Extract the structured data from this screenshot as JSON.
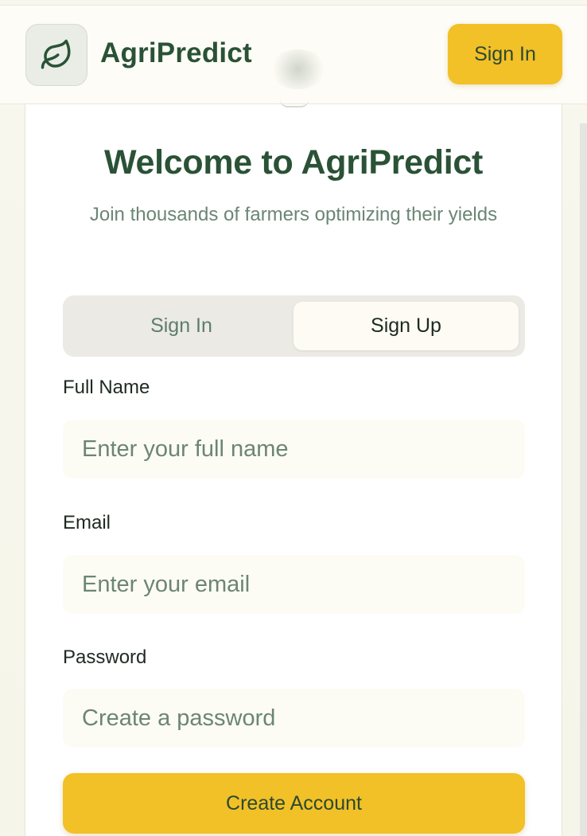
{
  "header": {
    "brand": "AgriPredict",
    "logo_icon": "leaf-icon",
    "signin_label": "Sign In"
  },
  "card": {
    "title": "Welcome to AgriPredict",
    "subtitle": "Join thousands of farmers optimizing their yields"
  },
  "tabs": [
    {
      "label": "Sign In",
      "active": false
    },
    {
      "label": "Sign Up",
      "active": true
    }
  ],
  "form": {
    "full_name": {
      "label": "Full Name",
      "placeholder": "Enter your full name",
      "value": ""
    },
    "email": {
      "label": "Email",
      "placeholder": "Enter your email",
      "value": ""
    },
    "password": {
      "label": "Password",
      "placeholder": "Create a password",
      "value": ""
    },
    "submit_label": "Create Account"
  },
  "colors": {
    "brand_green": "#2a5236",
    "accent_yellow": "#f2c027",
    "muted_green": "#6b8675"
  }
}
